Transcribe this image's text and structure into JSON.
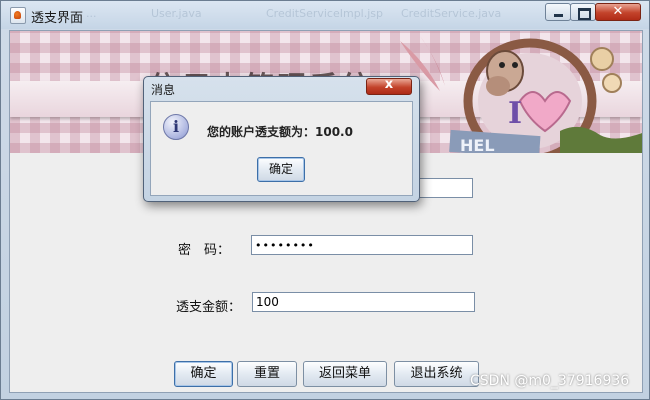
{
  "window": {
    "title": "透支界面",
    "background_tabs": [
      "...",
      "User.java",
      "CreditServiceImpl.jsp",
      "CreditService.java"
    ]
  },
  "banner": {
    "system_title": "信用卡管理系统",
    "sign_text": "HEL"
  },
  "form": {
    "password_label": "密　码：",
    "password_value": "••••••••",
    "overdraft_label": "透支金额：",
    "overdraft_value": "100"
  },
  "buttons": {
    "confirm": "确定",
    "reset": "重置",
    "back_to_menu": "返回菜单",
    "exit_system": "退出系统"
  },
  "dialog": {
    "title": "消息",
    "message": "您的账户透支额为：100.0",
    "ok_label": "确定",
    "icon": "info-icon"
  },
  "watermark": "CSDN @m0_37916936",
  "colors": {
    "close_button": "#c3432b",
    "titlebar": "#c5d5e6",
    "client_background": "#eeeeee"
  }
}
